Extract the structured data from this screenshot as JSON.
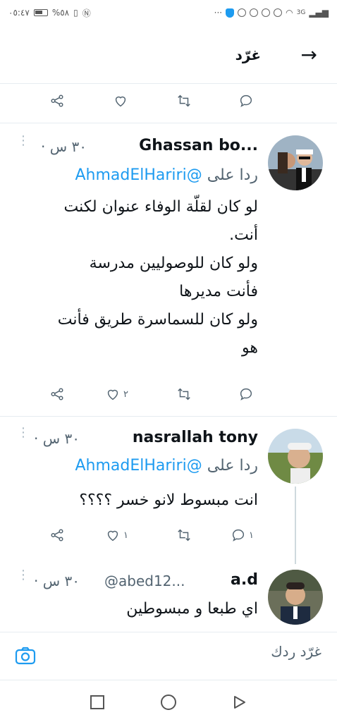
{
  "status_bar": {
    "time": "٠٥:٤٧",
    "battery": "%٥٨",
    "network": "3G"
  },
  "header": {
    "title": "غرّد"
  },
  "tweets": [
    {
      "name": "Ghassan bo...",
      "handle": "",
      "time": "٣٠ س ·",
      "reply_prefix": "ردا على",
      "mention": "@AhmadElHariri",
      "lines": [
        "لو كان لقلّة الوفاء عنوان لكنت",
        "أنت.",
        "ولو كان للوصوليين مدرسة",
        "فأنت مديرها",
        "ولو كان للسماسرة طريق فأنت",
        "هو"
      ],
      "reply_count": "",
      "retweet_count": "",
      "like_count": "٢"
    },
    {
      "name": "nasrallah tony",
      "time": "٣٠ س ·",
      "reply_prefix": "ردا على",
      "mention": "@AhmadElHariri",
      "lines": [
        "انت مبسوط لانو خسر ؟؟؟؟"
      ],
      "reply_count": "١",
      "retweet_count": "",
      "like_count": "١"
    },
    {
      "name": "a.d",
      "handle": "@abed12...",
      "time": "٣٠ س ·",
      "lines": [
        "اي طبعا و مبسوطين"
      ]
    }
  ],
  "compose": {
    "placeholder": "غرّد ردك"
  },
  "colors": {
    "accent": "#1d9bf0",
    "muted": "#536471",
    "divider": "#e6ecf0"
  }
}
